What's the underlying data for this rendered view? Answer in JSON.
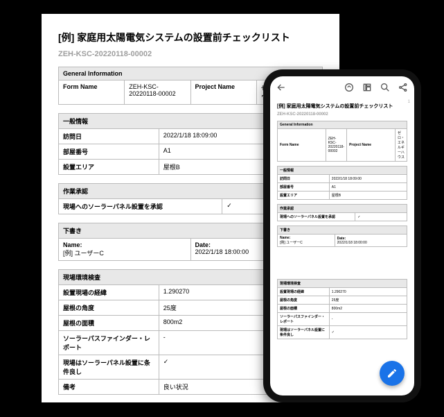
{
  "title": "[例] 家庭用太陽電気システムの設置前チェックリスト",
  "doc_id": "ZEH-KSC-20220118-00002",
  "general": {
    "section": "General Information",
    "form_name_label": "Form Name",
    "form_name_value": "ZEH-KSC-20220118-00002",
    "project_name_label": "Project Name",
    "project_name_value": "ゼロ・エネルギーハウス"
  },
  "ippan": {
    "section": "一般情報",
    "rows": [
      {
        "k": "訪問日",
        "v": "2022/1/18 18:09:00"
      },
      {
        "k": "部屋番号",
        "v": "A1"
      },
      {
        "k": "設置エリア",
        "v": "屋根B"
      }
    ]
  },
  "sagyou": {
    "section": "作業承認",
    "k": "現場へのソーラーパネル設置を承認",
    "v": "✓"
  },
  "shitagaki": {
    "section": "下書き",
    "name_label": "Name:",
    "name_value": "[例] ユーザーC",
    "date_label": "Date:",
    "date_value": "2022/1/18 18:00:00"
  },
  "genba": {
    "section": "現場環境検査",
    "rows": [
      {
        "k": "設置現場の経緯",
        "v": "1.290270"
      },
      {
        "k": "屋根の角度",
        "v": "25度"
      },
      {
        "k": "屋根の面積",
        "v": "800m2"
      },
      {
        "k": "ソーラーパスファインダー・レポート",
        "v": "-"
      },
      {
        "k": "現場はソーラーパネル設置に条件良し",
        "v": "✓"
      },
      {
        "k": "備考",
        "v": "良い状況"
      }
    ]
  },
  "phone": {
    "page_indicator": "1"
  }
}
